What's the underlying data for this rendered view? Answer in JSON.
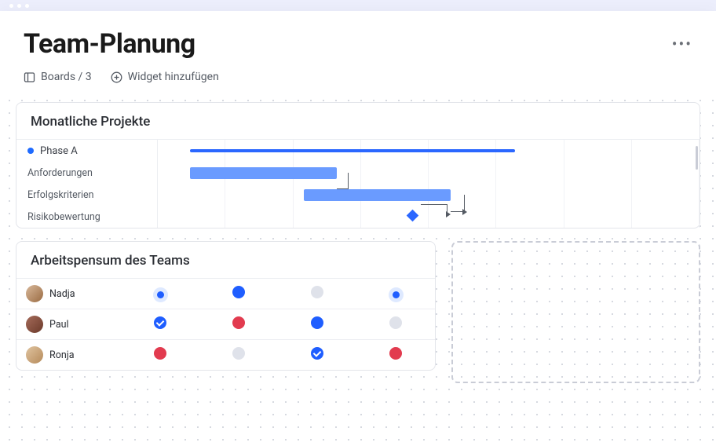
{
  "header": {
    "title": "Team-Planung",
    "boards_label": "Boards / 3",
    "add_widget_label": "Widget hinzufügen"
  },
  "gantt": {
    "title": "Monatliche Projekte",
    "phase_label": "Phase A",
    "rows": {
      "r1": "Anforderungen",
      "r2": "Erfolgskriterien",
      "r3": "Risikobewertung"
    }
  },
  "workload": {
    "title": "Arbeitspensum des Teams",
    "members": {
      "m0": "Nadja",
      "m1": "Paul",
      "m2": "Ronja"
    }
  }
}
